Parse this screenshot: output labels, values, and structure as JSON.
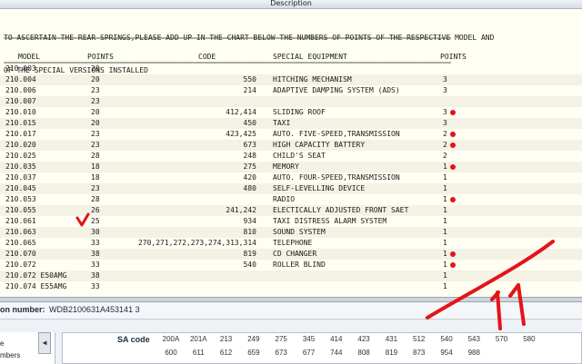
{
  "window": {
    "title": "Description"
  },
  "intro": {
    "line1": "TO ASCERTAIN THE REAR SPRINGS,PLEASE ADD UP IN THE CHART BELOW THE NUMBERS OF POINTS OF THE RESPECTIVE MODEL AND",
    "line2": "OF THE SPECIAL VERSIONS INSTALLED",
    "separator": "=============================================================================================================================================================="
  },
  "table": {
    "headers": {
      "model": "MODEL",
      "points": "POINTS",
      "code": "CODE",
      "equipment": "SPECIAL EQUIPMENT",
      "points2": "POINTS"
    },
    "rows": [
      {
        "model": "210.003",
        "points": "20",
        "code": "",
        "equipment": "",
        "points2": "",
        "dot": false
      },
      {
        "model": "210.004",
        "points": "20",
        "code": "550",
        "equipment": "HITCHING MECHANISM",
        "points2": "3",
        "dot": false
      },
      {
        "model": "210.006",
        "points": "23",
        "code": "214",
        "equipment": "ADAPTIVE DAMPING SYSTEM (ADS)",
        "points2": "3",
        "dot": false
      },
      {
        "model": "210.007",
        "points": "23",
        "code": "",
        "equipment": "",
        "points2": "",
        "dot": false
      },
      {
        "model": "210.010",
        "points": "20",
        "code": "412,414",
        "equipment": "SLIDING ROOF",
        "points2": "3",
        "dot": true
      },
      {
        "model": "210.015",
        "points": "20",
        "code": "450",
        "equipment": "TAXI",
        "points2": "3",
        "dot": false
      },
      {
        "model": "210.017",
        "points": "23",
        "code": "423,425",
        "equipment": "AUTO. FIVE-SPEED,TRANSMISSION",
        "points2": "2",
        "dot": true
      },
      {
        "model": "210.020",
        "points": "23",
        "code": "673",
        "equipment": "HIGH CAPACITY BATTERY",
        "points2": "2",
        "dot": true
      },
      {
        "model": "210.025",
        "points": "28",
        "code": "248",
        "equipment": "CHILD'S SEAT",
        "points2": "2",
        "dot": false
      },
      {
        "model": "210.035",
        "points": "18",
        "code": "275",
        "equipment": "MEMORY",
        "points2": "1",
        "dot": true
      },
      {
        "model": "210.037",
        "points": "18",
        "code": "420",
        "equipment": "AUTO. FOUR-SPEED,TRANSMISSION",
        "points2": "1",
        "dot": false
      },
      {
        "model": "210.045",
        "points": "23",
        "code": "480",
        "equipment": "SELF-LEVELLING DEVICE",
        "points2": "1",
        "dot": false
      },
      {
        "model": "210.053",
        "points": "28",
        "code": "",
        "equipment": "RADIO",
        "points2": "1",
        "dot": true
      },
      {
        "model": "210.055",
        "points": "26",
        "code": "241,242",
        "equipment": "ELECTICALLY ADJUSTED FRONT SAET",
        "points2": "1",
        "dot": false
      },
      {
        "model": "210.061",
        "points": "25",
        "code": "934",
        "equipment": "TAXI DISTRESS ALARM SYSTEM",
        "points2": "1",
        "dot": false
      },
      {
        "model": "210.063",
        "points": "30",
        "code": "810",
        "equipment": "SOUND SYSTEM",
        "points2": "1",
        "dot": false
      },
      {
        "model": "210.065",
        "points": "33",
        "code": "270,271,272,273,274,313,314",
        "equipment": "TELEPHONE",
        "points2": "1",
        "dot": false
      },
      {
        "model": "210.070",
        "points": "38",
        "code": "819",
        "equipment": "CD CHANGER",
        "points2": "1",
        "dot": true
      },
      {
        "model": "210.072",
        "points": "33",
        "code": "540",
        "equipment": "ROLLER BLIND",
        "points2": "1",
        "dot": true
      },
      {
        "model": "210.072 E50AMG",
        "points": "38",
        "code": "",
        "equipment": "",
        "points2": "1",
        "dot": false
      },
      {
        "model": "210.074 E55AMG",
        "points": "33",
        "code": "",
        "equipment": "",
        "points2": "1",
        "dot": false
      }
    ]
  },
  "vin": {
    "label": "on number:",
    "value": "WDB2100631A453141 3"
  },
  "side_list": {
    "item1": "e",
    "item2": "mbers"
  },
  "sa": {
    "label": "SA code",
    "row1": [
      "200A",
      "201A",
      "213",
      "249",
      "275",
      "345",
      "414",
      "423",
      "431",
      "512",
      "540",
      "543",
      "570",
      "580"
    ],
    "row2": [
      "600",
      "611",
      "612",
      "659",
      "673",
      "677",
      "744",
      "808",
      "819",
      "873",
      "954",
      "988"
    ]
  },
  "colors": {
    "annotation": "#e3141a",
    "panel": "#fffef2"
  }
}
